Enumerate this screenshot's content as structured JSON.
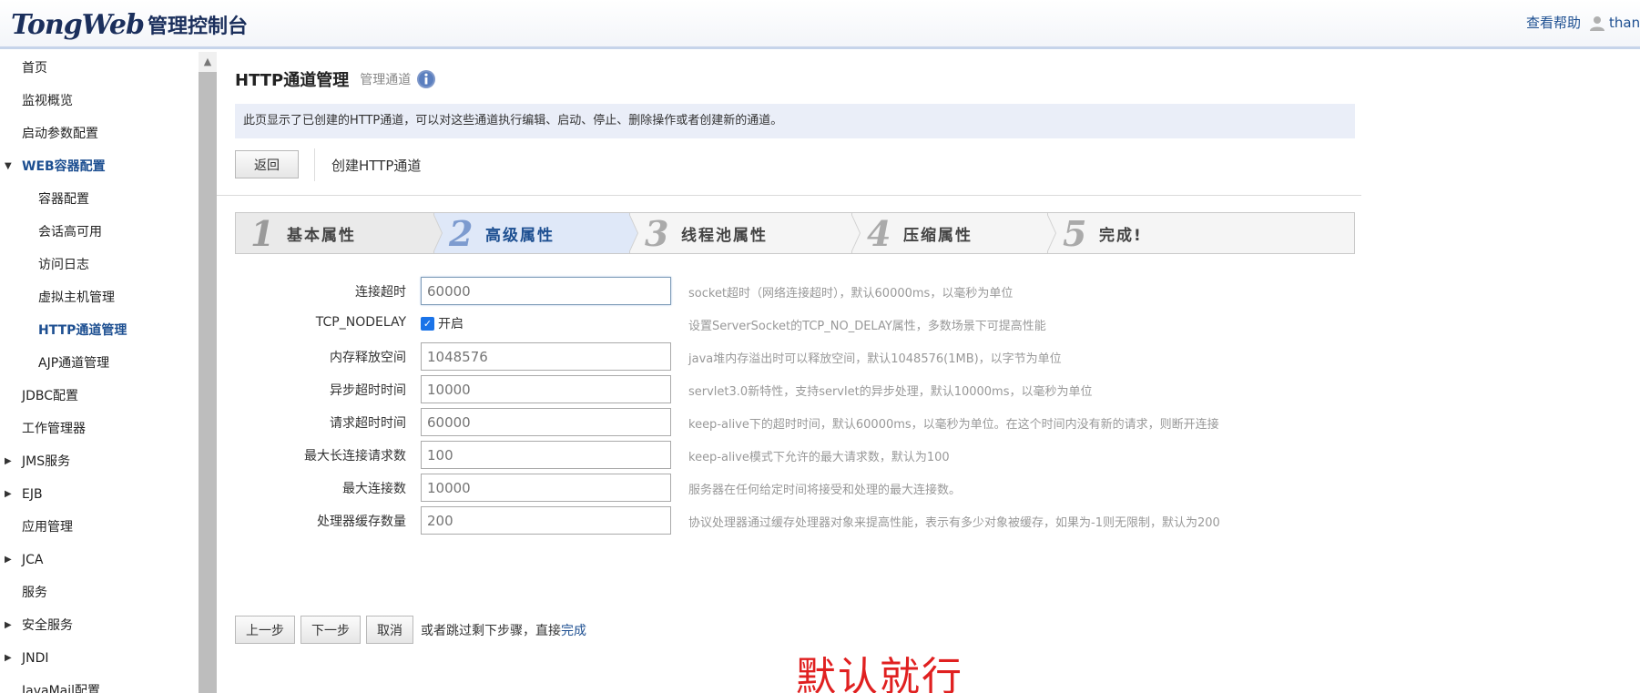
{
  "header": {
    "logo_brand": "TongWeb",
    "logo_sub": "管理控制台",
    "help_link": "查看帮助",
    "user_name": "thanc"
  },
  "sidebar": {
    "items": [
      {
        "label": "首页",
        "level": 1,
        "expandable": false
      },
      {
        "label": "监视概览",
        "level": 1,
        "expandable": false
      },
      {
        "label": "启动参数配置",
        "level": 1,
        "expandable": false
      },
      {
        "label": "WEB容器配置",
        "level": 1,
        "expandable": true,
        "expanded": true
      },
      {
        "label": "容器配置",
        "level": 2
      },
      {
        "label": "会话高可用",
        "level": 2
      },
      {
        "label": "访问日志",
        "level": 2
      },
      {
        "label": "虚拟主机管理",
        "level": 2
      },
      {
        "label": "HTTP通道管理",
        "level": 2,
        "active": true
      },
      {
        "label": "AJP通道管理",
        "level": 2
      },
      {
        "label": "JDBC配置",
        "level": 1,
        "expandable": false
      },
      {
        "label": "工作管理器",
        "level": 1,
        "expandable": false
      },
      {
        "label": "JMS服务",
        "level": 1,
        "expandable": true
      },
      {
        "label": "EJB",
        "level": 1,
        "expandable": true
      },
      {
        "label": "应用管理",
        "level": 1,
        "expandable": false
      },
      {
        "label": "JCA",
        "level": 1,
        "expandable": true
      },
      {
        "label": "服务",
        "level": 1,
        "expandable": false
      },
      {
        "label": "安全服务",
        "level": 1,
        "expandable": true
      },
      {
        "label": "JNDI",
        "level": 1,
        "expandable": true
      },
      {
        "label": "JavaMail配置",
        "level": 1,
        "expandable": false
      }
    ]
  },
  "main": {
    "title": "HTTP通道管理",
    "subtitle": "管理通道",
    "description": "此页显示了已创建的HTTP通道，可以对这些通道执行编辑、启动、停止、删除操作或者创建新的通道。",
    "back_label": "返回",
    "create_label": "创建HTTP通道",
    "steps": [
      {
        "num": "1",
        "label": "基本属性",
        "state": "done"
      },
      {
        "num": "2",
        "label": "高级属性",
        "state": "current"
      },
      {
        "num": "3",
        "label": "线程池属性",
        "state": "todo"
      },
      {
        "num": "4",
        "label": "压缩属性",
        "state": "todo"
      },
      {
        "num": "5",
        "label": "完成!",
        "state": "todo"
      }
    ],
    "fields": [
      {
        "label": "连接超时",
        "placeholder": "60000",
        "hint": "socket超时（网络连接超时），默认60000ms，以毫秒为单位"
      },
      {
        "label": "TCP_NODELAY",
        "checkbox": true,
        "checked": true,
        "check_label": "开启",
        "hint": "设置ServerSocket的TCP_NO_DELAY属性，多数场景下可提高性能"
      },
      {
        "label": "内存释放空间",
        "placeholder": "1048576",
        "hint": "java堆内存溢出时可以释放空间，默认1048576(1MB)，以字节为单位"
      },
      {
        "label": "异步超时时间",
        "placeholder": "10000",
        "hint": "servlet3.0新特性，支持servlet的异步处理，默认10000ms，以毫秒为单位"
      },
      {
        "label": "请求超时时间",
        "placeholder": "60000",
        "hint": "keep-alive下的超时时间，默认60000ms，以毫秒为单位。在这个时间内没有新的请求，则断开连接"
      },
      {
        "label": "最大长连接请求数",
        "placeholder": "100",
        "hint": "keep-alive模式下允许的最大请求数，默认为100"
      },
      {
        "label": "最大连接数",
        "placeholder": "10000",
        "hint": "服务器在任何给定时间将接受和处理的最大连接数。"
      },
      {
        "label": "处理器缓存数量",
        "placeholder": "200",
        "hint": "协议处理器通过缓存处理器对象来提高性能，表示有多少对象被缓存，如果为-1则无限制，默认为200"
      }
    ],
    "buttons": {
      "prev": "上一步",
      "next": "下一步",
      "cancel": "取消"
    },
    "skip_text": "或者跳过剩下步骤，直接",
    "finish_link": "完成",
    "annotation": "默认就行"
  }
}
